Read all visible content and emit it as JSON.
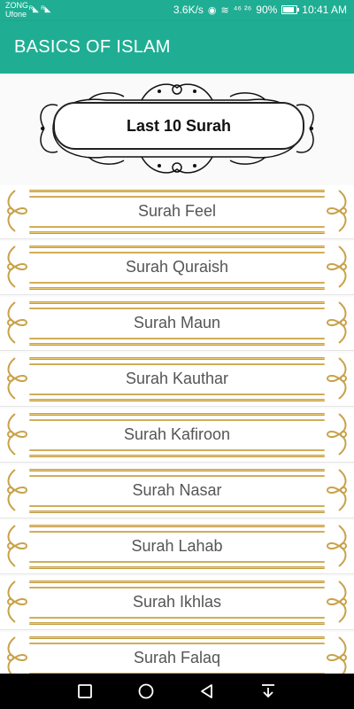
{
  "status_bar": {
    "carrier_1": "ZONG",
    "carrier_2": "Ufone",
    "carrier_icons": "ᴿ◣ ᴿ◣",
    "speed": "3.6K/s",
    "signal_text": "⁴⁶ ²⁶",
    "battery": "90%",
    "time": "10:41 AM"
  },
  "app_bar": {
    "title": "BASICS OF ISLAM"
  },
  "header": {
    "title": "Last 10 Surah"
  },
  "surahs": [
    {
      "label": "Surah Feel"
    },
    {
      "label": "Surah Quraish"
    },
    {
      "label": "Surah Maun"
    },
    {
      "label": "Surah Kauthar"
    },
    {
      "label": "Surah Kafiroon"
    },
    {
      "label": "Surah Nasar"
    },
    {
      "label": "Surah Lahab"
    },
    {
      "label": "Surah Ikhlas"
    },
    {
      "label": "Surah Falaq"
    }
  ],
  "colors": {
    "primary": "#1fae93",
    "gold": "#c9a24a"
  }
}
